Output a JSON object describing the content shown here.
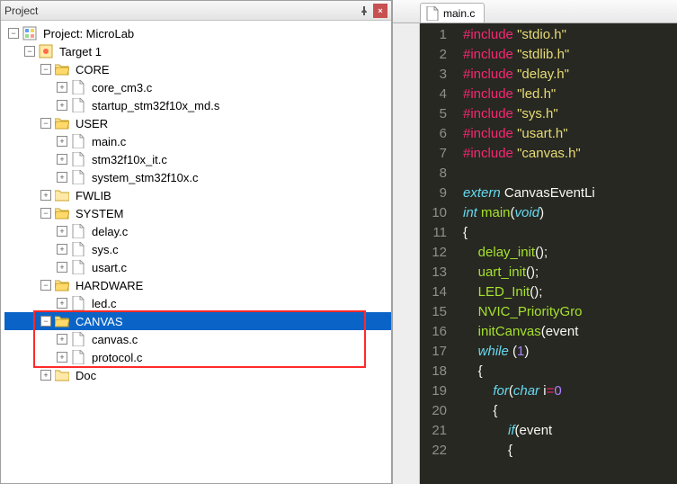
{
  "panel": {
    "title": "Project",
    "pin_glyph": "▾",
    "close_glyph": "×"
  },
  "tree": {
    "root_label": "Project: MicroLab",
    "target_label": "Target 1",
    "groups": [
      {
        "name": "CORE",
        "open": true,
        "files": [
          "core_cm3.c",
          "startup_stm32f10x_md.s"
        ]
      },
      {
        "name": "USER",
        "open": true,
        "files": [
          "main.c",
          "stm32f10x_it.c",
          "system_stm32f10x.c"
        ]
      },
      {
        "name": "FWLIB",
        "open": false,
        "files": []
      },
      {
        "name": "SYSTEM",
        "open": true,
        "files": [
          "delay.c",
          "sys.c",
          "usart.c"
        ]
      },
      {
        "name": "HARDWARE",
        "open": true,
        "files": [
          "led.c"
        ]
      },
      {
        "name": "CANVAS",
        "open": true,
        "selected": true,
        "files": [
          "canvas.c",
          "protocol.c"
        ]
      },
      {
        "name": "Doc",
        "open": false,
        "files": []
      }
    ]
  },
  "editor": {
    "tab": "main.c",
    "code": [
      {
        "n": 1,
        "tokens": [
          [
            "pre",
            "#include"
          ],
          [
            "sp",
            " "
          ],
          [
            "str",
            "\"stdio.h\""
          ]
        ]
      },
      {
        "n": 2,
        "tokens": [
          [
            "pre",
            "#include"
          ],
          [
            "sp",
            " "
          ],
          [
            "str",
            "\"stdlib.h\""
          ]
        ]
      },
      {
        "n": 3,
        "tokens": [
          [
            "pre",
            "#include"
          ],
          [
            "sp",
            " "
          ],
          [
            "str",
            "\"delay.h\""
          ]
        ]
      },
      {
        "n": 4,
        "tokens": [
          [
            "pre",
            "#include"
          ],
          [
            "sp",
            " "
          ],
          [
            "str",
            "\"led.h\""
          ]
        ]
      },
      {
        "n": 5,
        "tokens": [
          [
            "pre",
            "#include"
          ],
          [
            "sp",
            " "
          ],
          [
            "str",
            "\"sys.h\""
          ]
        ]
      },
      {
        "n": 6,
        "tokens": [
          [
            "pre",
            "#include"
          ],
          [
            "sp",
            " "
          ],
          [
            "str",
            "\"usart.h\""
          ]
        ]
      },
      {
        "n": 7,
        "tokens": [
          [
            "pre",
            "#include"
          ],
          [
            "sp",
            " "
          ],
          [
            "str",
            "\"canvas.h\""
          ]
        ]
      },
      {
        "n": 8,
        "tokens": []
      },
      {
        "n": 9,
        "tokens": [
          [
            "kw",
            "extern"
          ],
          [
            "sp",
            " "
          ],
          [
            "id",
            "CanvasEventLi"
          ]
        ]
      },
      {
        "n": 10,
        "tokens": [
          [
            "kw",
            "int"
          ],
          [
            "sp",
            " "
          ],
          [
            "fn",
            "main"
          ],
          [
            "punc",
            "("
          ],
          [
            "kw",
            "void"
          ],
          [
            "punc",
            ")"
          ]
        ]
      },
      {
        "n": 11,
        "tokens": [
          [
            "brace",
            "{"
          ]
        ]
      },
      {
        "n": 12,
        "tokens": [
          [
            "sp",
            "    "
          ],
          [
            "fn",
            "delay_init"
          ],
          [
            "punc",
            "();"
          ]
        ]
      },
      {
        "n": 13,
        "tokens": [
          [
            "sp",
            "    "
          ],
          [
            "fn",
            "uart_init"
          ],
          [
            "punc",
            "();"
          ]
        ]
      },
      {
        "n": 14,
        "tokens": [
          [
            "sp",
            "    "
          ],
          [
            "fn",
            "LED_Init"
          ],
          [
            "punc",
            "();"
          ]
        ]
      },
      {
        "n": 15,
        "tokens": [
          [
            "sp",
            "    "
          ],
          [
            "fn",
            "NVIC_PriorityGro"
          ]
        ]
      },
      {
        "n": 16,
        "tokens": [
          [
            "sp",
            "    "
          ],
          [
            "fn",
            "initCanvas"
          ],
          [
            "punc",
            "("
          ],
          [
            "id",
            "event"
          ]
        ]
      },
      {
        "n": 17,
        "tokens": [
          [
            "sp",
            "    "
          ],
          [
            "kw",
            "while"
          ],
          [
            "sp",
            " "
          ],
          [
            "punc",
            "("
          ],
          [
            "num",
            "1"
          ],
          [
            "punc",
            ")"
          ]
        ]
      },
      {
        "n": 18,
        "tokens": [
          [
            "sp",
            "    "
          ],
          [
            "brace",
            "{"
          ]
        ]
      },
      {
        "n": 19,
        "tokens": [
          [
            "sp",
            "        "
          ],
          [
            "kw",
            "for"
          ],
          [
            "punc",
            "("
          ],
          [
            "kw",
            "char"
          ],
          [
            "sp",
            " "
          ],
          [
            "id",
            "i"
          ],
          [
            "op",
            "="
          ],
          [
            "num",
            "0"
          ]
        ]
      },
      {
        "n": 20,
        "tokens": [
          [
            "sp",
            "        "
          ],
          [
            "brace",
            "{"
          ]
        ]
      },
      {
        "n": 21,
        "tokens": [
          [
            "sp",
            "            "
          ],
          [
            "kw",
            "if"
          ],
          [
            "punc",
            "("
          ],
          [
            "id",
            "event"
          ]
        ]
      },
      {
        "n": 22,
        "tokens": [
          [
            "sp",
            "            "
          ],
          [
            "brace",
            "{"
          ]
        ]
      }
    ]
  }
}
